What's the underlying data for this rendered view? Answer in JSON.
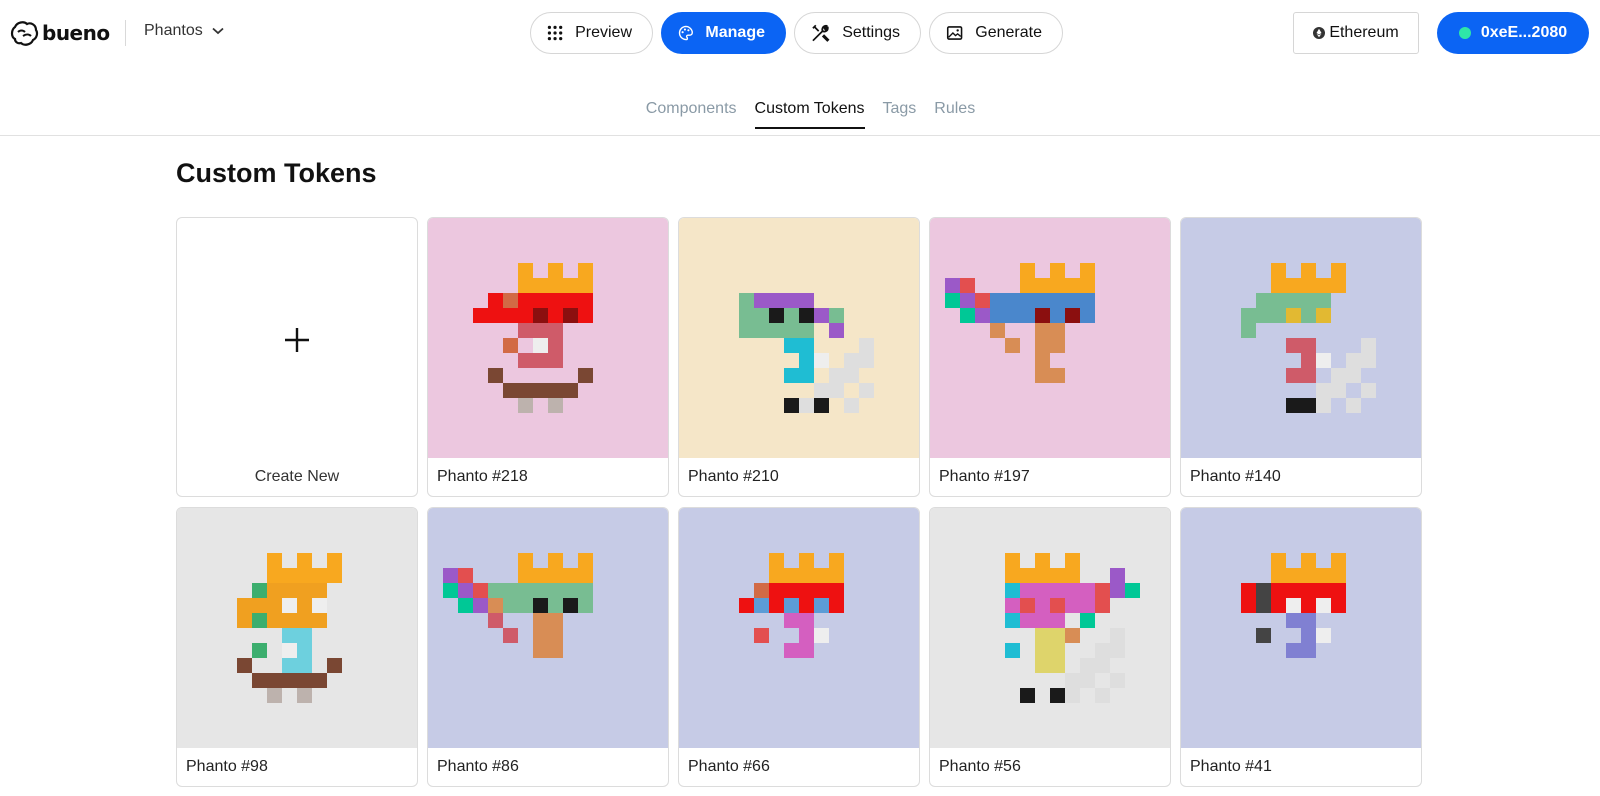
{
  "brand": {
    "name": "bueno"
  },
  "project": {
    "name": "Phantos"
  },
  "nav": {
    "preview": "Preview",
    "manage": "Manage",
    "settings": "Settings",
    "generate": "Generate"
  },
  "network": {
    "label": "Ethereum"
  },
  "wallet": {
    "address": "0xeE...2080",
    "status_color": "#2ee6a8"
  },
  "tabs": [
    "Components",
    "Custom Tokens",
    "Tags",
    "Rules"
  ],
  "active_tab": "Custom Tokens",
  "page_title": "Custom Tokens",
  "create_card": {
    "label": "Create New"
  },
  "tokens": [
    {
      "name": "Phanto #218",
      "background": "#ecc7df"
    },
    {
      "name": "Phanto #210",
      "background": "#f5e6c8"
    },
    {
      "name": "Phanto #197",
      "background": "#ecc7df"
    },
    {
      "name": "Phanto #140",
      "background": "#c6cbe6"
    },
    {
      "name": "Phanto #98",
      "background": "#e6e6e6"
    },
    {
      "name": "Phanto #86",
      "background": "#c6cbe6"
    },
    {
      "name": "Phanto #66",
      "background": "#c6cbe6"
    },
    {
      "name": "Phanto #56",
      "background": "#e6e6e6"
    },
    {
      "name": "Phanto #41",
      "background": "#c6cbe6"
    }
  ],
  "colors": {
    "accent": "#0b64f4",
    "tab_inactive": "#8a9aa6"
  }
}
